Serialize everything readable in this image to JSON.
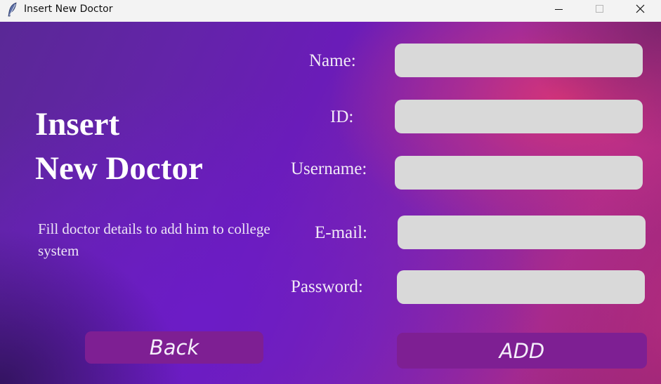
{
  "window": {
    "title": "Insert New Doctor",
    "icon": "feather-icon",
    "controls": [
      "minimize-icon",
      "maximize-icon",
      "close-icon"
    ]
  },
  "heading": {
    "line1": "Insert",
    "line2": "New Doctor"
  },
  "description": "Fill doctor details to add him to college system",
  "form": {
    "name_label": "Name:",
    "name_value": "",
    "id_label": "ID:",
    "id_value": "",
    "username_label": "Username:",
    "username_value": "",
    "email_label": "E-mail:",
    "email_value": "",
    "password_label": "Password:",
    "password_value": ""
  },
  "buttons": {
    "back_label": "Back",
    "add_label": "ADD"
  },
  "colors": {
    "input_background": "#d9d9d9",
    "button_background": "#7e1f93",
    "background_purple": "#6a1cb8",
    "background_pink": "#d63478"
  }
}
